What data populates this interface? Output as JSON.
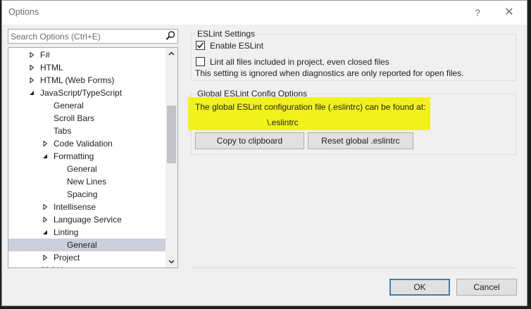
{
  "window": {
    "title": "Options",
    "help_glyph": "?",
    "close_glyph": "✕"
  },
  "search": {
    "placeholder": "Search Options (Ctrl+E)",
    "value": ""
  },
  "tree": {
    "items": [
      {
        "label": "F#",
        "level": 1,
        "expander": "collapsed",
        "selected": false
      },
      {
        "label": "HTML",
        "level": 1,
        "expander": "collapsed",
        "selected": false
      },
      {
        "label": "HTML (Web Forms)",
        "level": 1,
        "expander": "collapsed",
        "selected": false
      },
      {
        "label": "JavaScript/TypeScript",
        "level": 1,
        "expander": "expanded",
        "selected": false
      },
      {
        "label": "General",
        "level": 2,
        "expander": "none",
        "selected": false
      },
      {
        "label": "Scroll Bars",
        "level": 2,
        "expander": "none",
        "selected": false
      },
      {
        "label": "Tabs",
        "level": 2,
        "expander": "none",
        "selected": false
      },
      {
        "label": "Code Validation",
        "level": 2,
        "expander": "collapsed",
        "selected": false
      },
      {
        "label": "Formatting",
        "level": 2,
        "expander": "expanded",
        "selected": false
      },
      {
        "label": "General",
        "level": 3,
        "expander": "none",
        "selected": false
      },
      {
        "label": "New Lines",
        "level": 3,
        "expander": "none",
        "selected": false
      },
      {
        "label": "Spacing",
        "level": 3,
        "expander": "none",
        "selected": false
      },
      {
        "label": "Intellisense",
        "level": 2,
        "expander": "collapsed",
        "selected": false
      },
      {
        "label": "Language Service",
        "level": 2,
        "expander": "collapsed",
        "selected": false
      },
      {
        "label": "Linting",
        "level": 2,
        "expander": "expanded",
        "selected": false
      },
      {
        "label": "General",
        "level": 3,
        "expander": "none",
        "selected": true
      },
      {
        "label": "Project",
        "level": 2,
        "expander": "collapsed",
        "selected": false
      },
      {
        "label": "JSON",
        "level": 1,
        "expander": "collapsed",
        "selected": false
      }
    ]
  },
  "eslint_settings": {
    "legend": "ESLint Settings",
    "enable_label": "Enable ESLint",
    "enable_checked": true,
    "lint_all_label": "Lint all files included in project, even closed files",
    "lint_all_checked": false,
    "note": "This setting is ignored when diagnostics are only reported for open files."
  },
  "global_config": {
    "legend": "Global ESLint Config Options",
    "description": "The global ESLint configuration file (.eslintrc) can be found at:",
    "path": "\\.eslintrc",
    "copy_button": "Copy to clipboard",
    "reset_button": "Reset global .eslintrc"
  },
  "footer": {
    "ok_label": "OK",
    "cancel_label": "Cancel"
  },
  "colors": {
    "highlight": "#f2f21b",
    "selected_row": "#cccedb",
    "default_button_border": "#3c7fb1"
  }
}
